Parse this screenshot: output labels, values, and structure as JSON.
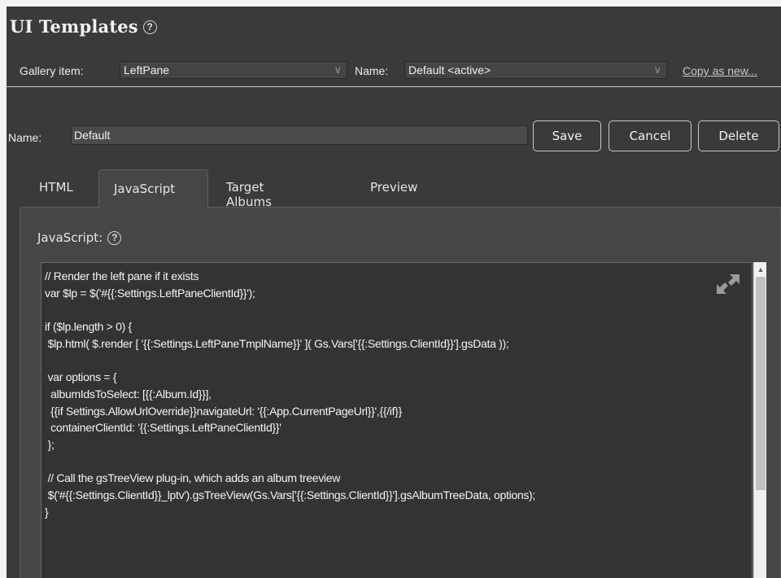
{
  "header": {
    "title": "UI Templates",
    "help": "?"
  },
  "gallery": {
    "gallery_item_label": "Gallery item:",
    "gallery_item_value": "LeftPane",
    "name_label": "Name:",
    "name_value": "Default <active>",
    "copy_link": "Copy as new..."
  },
  "form": {
    "name_label": "Name:",
    "name_value": "Default",
    "save_label": "Save",
    "cancel_label": "Cancel",
    "delete_label": "Delete"
  },
  "tabs": [
    {
      "label": "HTML",
      "active": false
    },
    {
      "label": "JavaScript",
      "active": true
    },
    {
      "label": "Target Albums",
      "active": false
    },
    {
      "label": "Preview",
      "active": false
    }
  ],
  "section": {
    "label": "JavaScript:",
    "help": "?"
  },
  "editor": {
    "lines": [
      "// Render the left pane if it exists",
      "var $lp = $('#{{:Settings.LeftPaneClientId}}');",
      "",
      "if ($lp.length > 0) {",
      " $lp.html( $.render [ '{{:Settings.LeftPaneTmplName}}' ]( Gs.Vars['{{:Settings.ClientId}}'].gsData ));",
      "",
      " var options = {",
      "  albumIdsToSelect: [{{:Album.Id}}],",
      "  {{if Settings.AllowUrlOverride}}navigateUrl: '{{:App.CurrentPageUrl}}',{{/if}}",
      "  containerClientId: '{{:Settings.LeftPaneClientId}}'",
      " };",
      "",
      " // Call the gsTreeView plug-in, which adds an album treeview",
      " $('#{{:Settings.ClientId}}_lptv').gsTreeView(Gs.Vars['{{:Settings.ClientId}}'].gsAlbumTreeData, options);",
      "}"
    ]
  }
}
